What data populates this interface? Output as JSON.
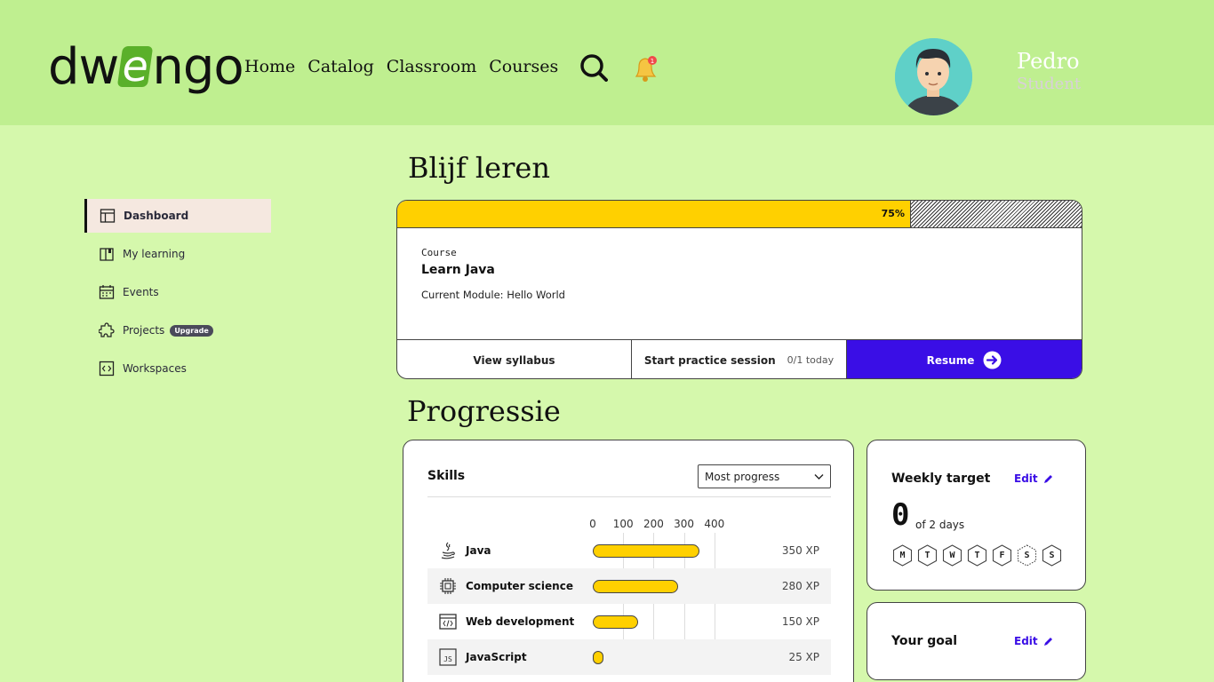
{
  "header": {
    "logo": {
      "part1": "dw",
      "part2": "e",
      "part3": "ngo"
    },
    "nav": [
      "Home",
      "Catalog",
      "Classroom",
      "Courses"
    ],
    "notification_count": "1",
    "user": {
      "name": "Pedro",
      "role": "Student"
    }
  },
  "sidebar": {
    "items": [
      {
        "label": "Dashboard",
        "icon": "layout-icon",
        "active": true
      },
      {
        "label": "My learning",
        "icon": "book-icon"
      },
      {
        "label": "Events",
        "icon": "calendar-icon"
      },
      {
        "label": "Projects",
        "icon": "puzzle-icon",
        "badge": "Upgrade"
      },
      {
        "label": "Workspaces",
        "icon": "code-icon"
      }
    ]
  },
  "continue": {
    "heading": "Blijf leren",
    "progress": 0.75,
    "progress_label": "75%",
    "kind": "Course",
    "title": "Learn Java",
    "module": "Current Module: Hello World",
    "view_syllabus": "View syllabus",
    "practice": "Start practice session",
    "practice_sub": "0/1 today",
    "resume": "Resume"
  },
  "progress": {
    "heading": "Progressie",
    "skills_title": "Skills",
    "sort_value": "Most progress",
    "axis_ticks": [
      "0",
      "100",
      "200",
      "300",
      "400"
    ],
    "axis_max": 400,
    "skills": [
      {
        "name": "Java",
        "xp": 350,
        "xp_label": "350 XP",
        "icon": "java-icon"
      },
      {
        "name": "Computer science",
        "xp": 280,
        "xp_label": "280 XP",
        "icon": "chip-icon"
      },
      {
        "name": "Web development",
        "xp": 150,
        "xp_label": "150 XP",
        "icon": "browser-code-icon"
      },
      {
        "name": "JavaScript",
        "xp": 25,
        "xp_label": "25 XP",
        "icon": "js-icon"
      }
    ]
  },
  "weekly": {
    "title": "Weekly target",
    "edit": "Edit",
    "count": "0",
    "of": "of 2 days",
    "days": [
      "M",
      "T",
      "W",
      "T",
      "F",
      "S",
      "S"
    ],
    "today_index": 5
  },
  "goal": {
    "title": "Your goal",
    "edit": "Edit"
  },
  "colors": {
    "accent": "#3a0ee6",
    "progress": "#ffd000",
    "header_bg": "#bfef90",
    "page_bg": "#d5f8ac"
  }
}
